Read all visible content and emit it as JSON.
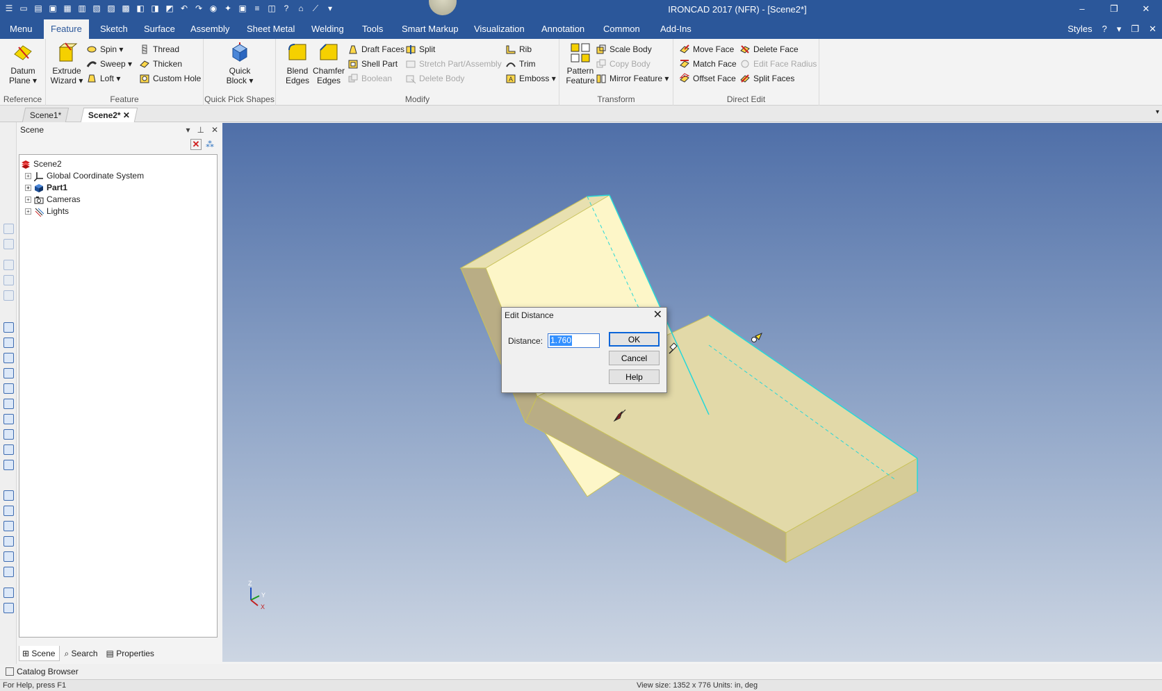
{
  "titlebar": {
    "title": "IRONCAD 2017 (NFR) - [Scene2*]",
    "minimize": "–",
    "restore": "❐",
    "close": "✕"
  },
  "ribbon_tabs": {
    "menu": "Menu",
    "feature": "Feature",
    "sketch": "Sketch",
    "surface": "Surface",
    "assembly": "Assembly",
    "sheet_metal": "Sheet Metal",
    "welding": "Welding",
    "tools": "Tools",
    "smart_markup": "Smart Markup",
    "visualization": "Visualization",
    "annotation": "Annotation",
    "common": "Common",
    "add_ins": "Add-Ins",
    "styles": "Styles"
  },
  "groups": {
    "reference": {
      "label": "Reference",
      "datum_plane": "Datum Plane"
    },
    "feature": {
      "label": "Feature",
      "extrude_wizard": "Extrude Wizard",
      "spin": "Spin",
      "sweep": "Sweep",
      "loft": "Loft",
      "thread": "Thread",
      "thicken": "Thicken",
      "custom_hole": "Custom Hole"
    },
    "quick_pick": {
      "label": "Quick Pick Shapes",
      "quick_block": "Quick Block"
    },
    "modify": {
      "label": "Modify",
      "blend_edges": "Blend Edges",
      "chamfer_edges": "Chamfer Edges",
      "draft_faces": "Draft Faces",
      "shell_part": "Shell Part",
      "boolean": "Boolean",
      "split": "Split",
      "stretch": "Stretch Part/Assembly",
      "delete_body": "Delete Body",
      "rib": "Rib",
      "trim": "Trim",
      "emboss": "Emboss"
    },
    "transform": {
      "label": "Transform",
      "pattern_feature": "Pattern Feature",
      "scale_body": "Scale Body",
      "copy_body": "Copy Body",
      "mirror_feature": "Mirror Feature"
    },
    "direct_edit": {
      "label": "Direct Edit",
      "move_face": "Move Face",
      "match_face": "Match Face",
      "offset_face": "Offset Face",
      "delete_face": "Delete Face",
      "edit_face_radius": "Edit Face Radius",
      "split_faces": "Split Faces"
    }
  },
  "doc_tabs": [
    "Scene1*",
    "Scene2*"
  ],
  "scene_panel": {
    "title": "Scene",
    "root": "Scene2",
    "nodes": [
      "Global Coordinate System",
      "Part1",
      "Cameras",
      "Lights"
    ],
    "bottom_tabs": [
      "Scene",
      "Search",
      "Properties"
    ]
  },
  "catalog": "Catalog Browser",
  "status": {
    "left": "For Help, press F1",
    "right": "View size: 1352 x 776  Units: in, deg"
  },
  "dialog": {
    "title": "Edit Distance",
    "distance_label": "Distance:",
    "distance_value": "1.760",
    "ok": "OK",
    "cancel": "Cancel",
    "help": "Help"
  },
  "triad": {
    "z": "Z",
    "y": "Y",
    "x": "X"
  },
  "colors": {
    "accent": "#2b579a",
    "part_face_light": "#fdf6c8",
    "part_face_mid": "#e2d9a8",
    "part_face_dark": "#b9ad85",
    "selected_edge": "#27d8d8"
  }
}
